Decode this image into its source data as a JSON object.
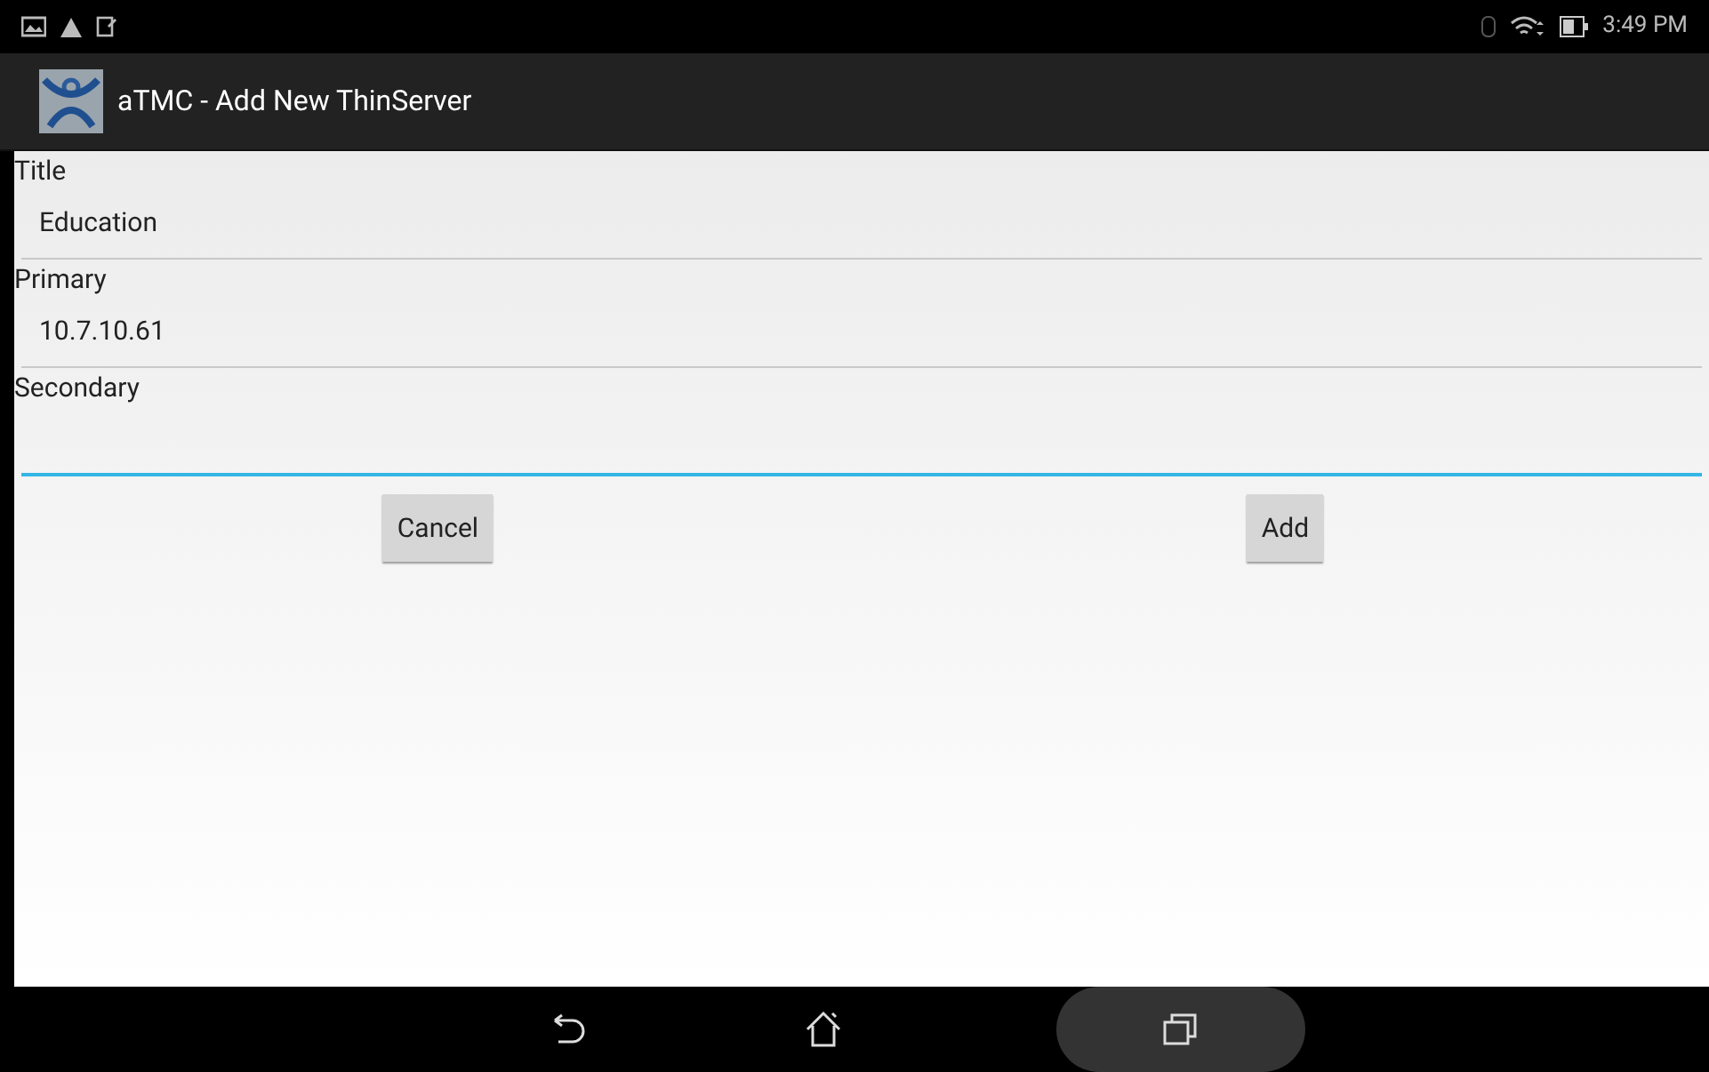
{
  "status_bar": {
    "time": "3:49 PM"
  },
  "action_bar": {
    "title": "aTMC - Add New ThinServer"
  },
  "fields": [
    {
      "label": "Title",
      "value": "Education",
      "focused": false
    },
    {
      "label": "Primary",
      "value": "10.7.10.61",
      "focused": false
    },
    {
      "label": "Secondary",
      "focused": true
    }
  ],
  "buttons": [
    "Cancel",
    "Add"
  ],
  "nav_bar": {
    "recents_pressed": true
  }
}
